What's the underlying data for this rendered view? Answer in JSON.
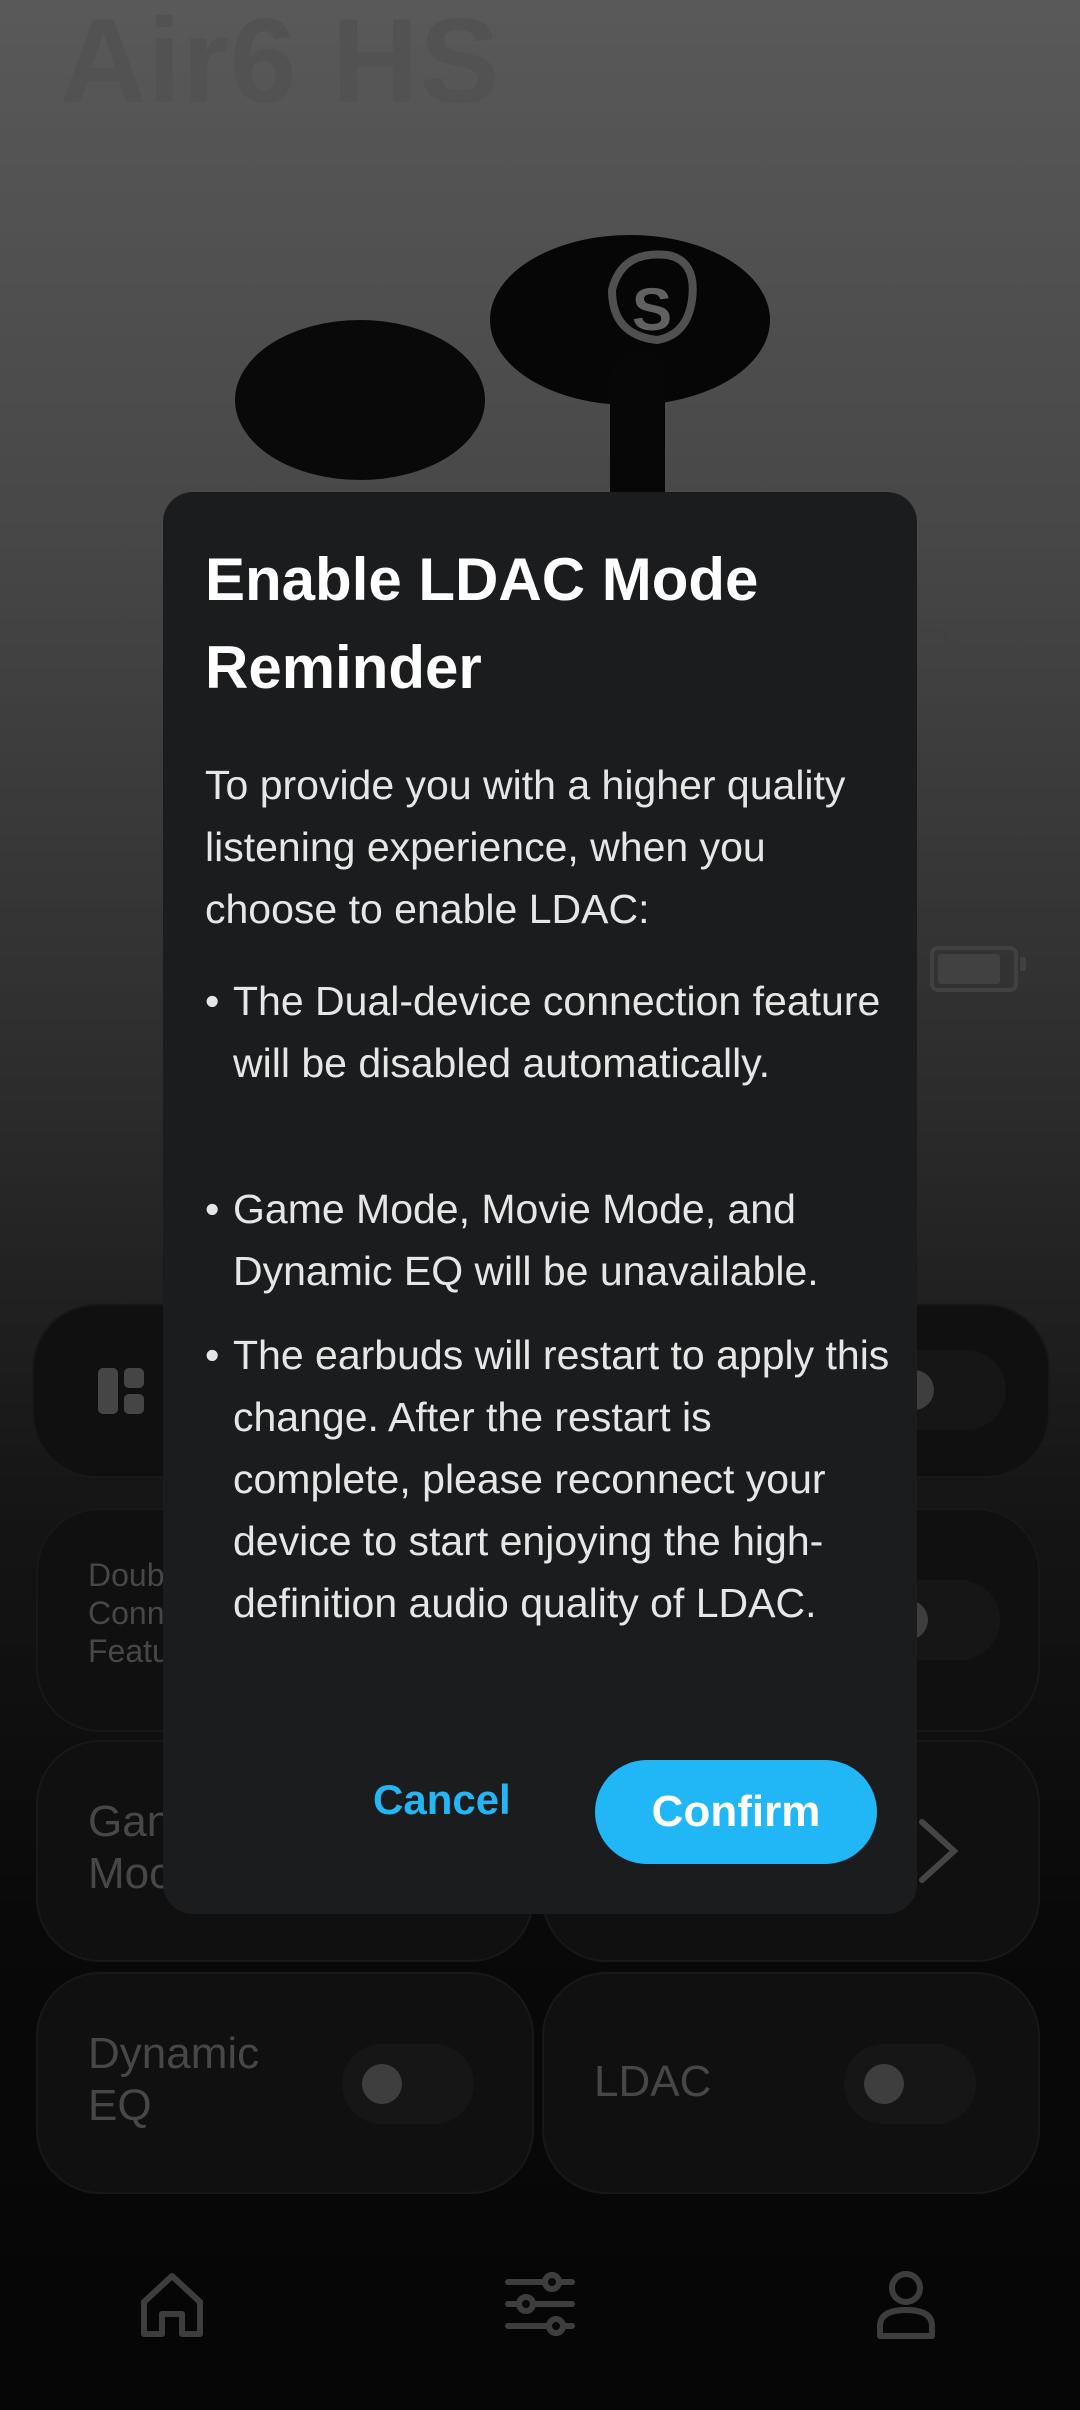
{
  "device": {
    "title": "Air6 HS"
  },
  "cards": {
    "double_connection": {
      "label_lines": [
        "Doub",
        "Conn",
        "Featu"
      ]
    },
    "game_mode": {
      "label_lines": [
        "Gan",
        "Moc"
      ]
    },
    "dynamic_eq": {
      "label_lines": [
        "Dynamic",
        "EQ"
      ],
      "enabled": false
    },
    "ldac": {
      "label": "LDAC",
      "enabled": false
    }
  },
  "battery": {
    "left_level": 0.85,
    "case_level": 0.85
  },
  "dialog": {
    "title": "Enable LDAC Mode Reminder",
    "intro": "To provide you with a higher quality listening experience, when you choose to enable LDAC:",
    "bullets": [
      "The Dual-device connection feature will be disabled automatically.",
      "Game Mode, Movie Mode, and Dynamic EQ will be unavailable.",
      "The earbuds will restart to apply this change. After the restart is complete, please reconnect your device to start enjoying the high-definition audio quality of LDAC."
    ],
    "bullet_symbol": "•",
    "cancel_label": "Cancel",
    "confirm_label": "Confirm"
  },
  "nav": {
    "icons": [
      "home-icon",
      "equalizer-icon",
      "profile-icon"
    ]
  },
  "colors": {
    "accent": "#21b7f7",
    "dialog_bg": "#1b1c1e"
  }
}
